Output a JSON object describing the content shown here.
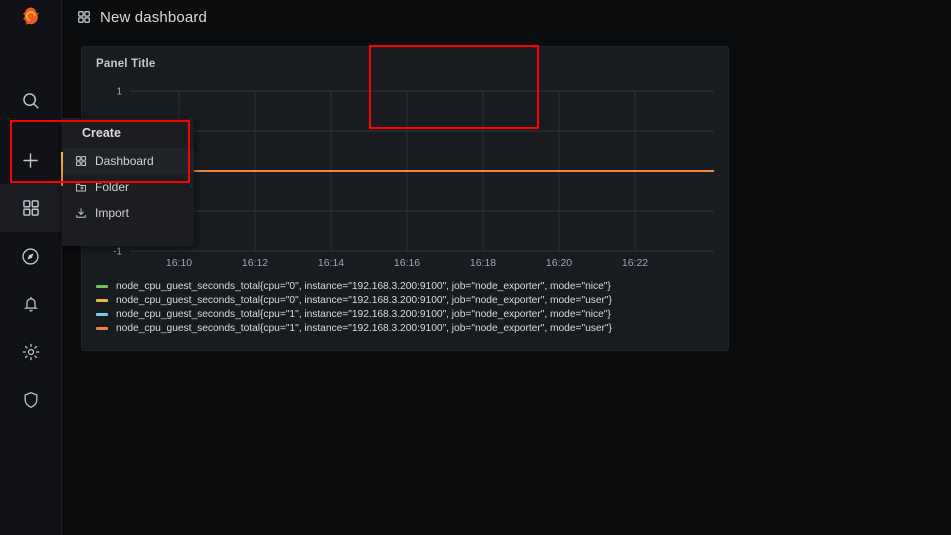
{
  "app": {
    "brand_icon": "grafana-logo-icon",
    "background": "#0b0c0e",
    "panel_background": "#181b1f"
  },
  "sidebar": {
    "items": [
      {
        "id": "search",
        "icon": "search-icon",
        "label": "Search",
        "active": false
      },
      {
        "id": "create",
        "icon": "plus-icon",
        "label": "Create",
        "active": false
      },
      {
        "id": "dashboards",
        "icon": "apps-grid-icon",
        "label": "Dashboards",
        "active": true
      },
      {
        "id": "explore",
        "icon": "compass-icon",
        "label": "Explore",
        "active": false
      },
      {
        "id": "alerting",
        "icon": "bell-icon",
        "label": "Alerting",
        "active": false
      },
      {
        "id": "config",
        "icon": "gear-icon",
        "label": "Configuration",
        "active": false
      },
      {
        "id": "admin",
        "icon": "shield-icon",
        "label": "Server Admin",
        "active": false
      }
    ]
  },
  "header": {
    "icon": "apps-grid-icon",
    "title": "New dashboard"
  },
  "create_menu": {
    "header": "Create",
    "items": [
      {
        "label": "Dashboard",
        "icon": "apps-grid-icon",
        "selected": true
      },
      {
        "label": "Folder",
        "icon": "folder-plus-icon",
        "selected": false
      },
      {
        "label": "Import",
        "icon": "import-icon",
        "selected": false
      }
    ]
  },
  "panel": {
    "title": "Panel Title"
  },
  "chart_data": {
    "type": "line",
    "title": "Panel Title",
    "xlabel": "",
    "ylabel": "",
    "x": [
      "16:10",
      "16:12",
      "16:14",
      "16:16",
      "16:18",
      "16:20",
      "16:22"
    ],
    "xtick_labels": [
      "16:10",
      "16:12",
      "16:14",
      "16:16",
      "16:18",
      "16:20",
      "16:22"
    ],
    "ytick_labels": [
      "1",
      "-1"
    ],
    "ylim": [
      -1,
      1
    ],
    "grid": true,
    "legend_position": "bottom",
    "series": [
      {
        "name": "node_cpu_guest_seconds_total{cpu=\"0\", instance=\"192.168.3.200:9100\", job=\"node_exporter\", mode=\"nice\"}",
        "color": "#73BF69",
        "values": [
          0,
          0,
          0,
          0,
          0,
          0,
          0
        ]
      },
      {
        "name": "node_cpu_guest_seconds_total{cpu=\"0\", instance=\"192.168.3.200:9100\", job=\"node_exporter\", mode=\"user\"}",
        "color": "#EAB839",
        "values": [
          0,
          0,
          0,
          0,
          0,
          0,
          0
        ]
      },
      {
        "name": "node_cpu_guest_seconds_total{cpu=\"1\", instance=\"192.168.3.200:9100\", job=\"node_exporter\", mode=\"nice\"}",
        "color": "#6ED0E0",
        "values": [
          0,
          0,
          0,
          0,
          0,
          0,
          0
        ]
      },
      {
        "name": "node_cpu_guest_seconds_total{cpu=\"1\", instance=\"192.168.3.200:9100\", job=\"node_exporter\", mode=\"user\"}",
        "color": "#EF843C",
        "values": [
          0,
          0,
          0,
          0,
          0,
          0,
          0
        ]
      }
    ]
  },
  "annotations": {
    "highlight_color": "#ff0000",
    "boxes": [
      {
        "name": "create-dashboard-menu-highlight"
      },
      {
        "name": "panel-title-highlight"
      }
    ]
  }
}
